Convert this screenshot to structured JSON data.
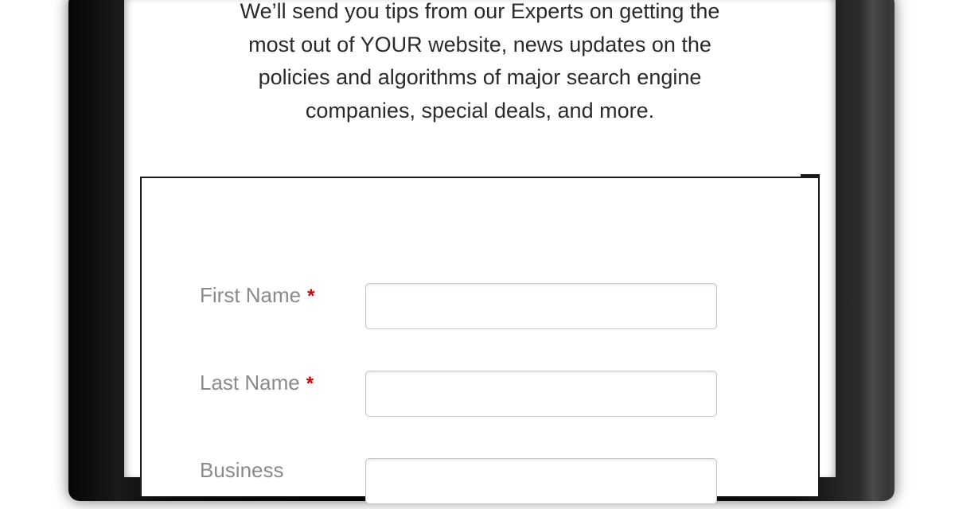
{
  "intro": {
    "lines": [
      "We’ll send you tips from our Experts on getting the",
      "most out of YOUR website, news updates on the",
      "policies and algorithms of major search engine",
      "companies, special deals, and more."
    ]
  },
  "form": {
    "fields": [
      {
        "label": "First Name",
        "required_mark": "*",
        "value": ""
      },
      {
        "label": "Last Name",
        "required_mark": "*",
        "value": ""
      },
      {
        "label": "Business",
        "required_mark": "",
        "value": ""
      }
    ]
  },
  "colors": {
    "required": "#d40000",
    "label": "#8a8a8a",
    "text": "#2a2a2a"
  }
}
